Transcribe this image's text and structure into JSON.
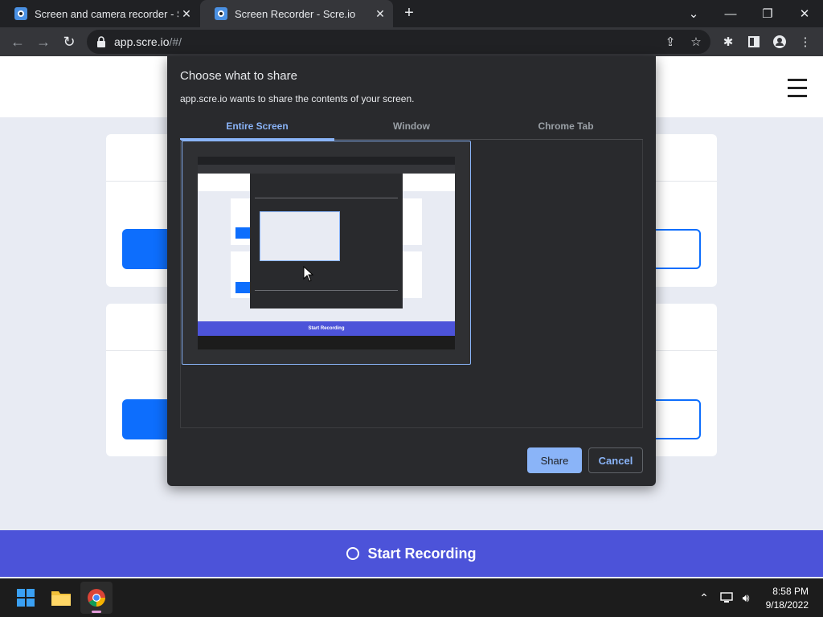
{
  "browser": {
    "tabs": [
      {
        "title": "Screen and camera recorder - Scre",
        "active": false
      },
      {
        "title": "Screen Recorder - Scre.io",
        "active": true
      }
    ],
    "new_tab": "+",
    "url_host": "app.scre.io",
    "url_path": "/#/"
  },
  "page": {
    "start_recording": "Start Recording"
  },
  "dialog": {
    "title": "Choose what to share",
    "subtitle": "app.scre.io wants to share the contents of your screen.",
    "tabs": [
      "Entire Screen",
      "Window",
      "Chrome Tab"
    ],
    "active_tab": "Entire Screen",
    "share_label": "Share",
    "cancel_label": "Cancel",
    "preview_caption": "Start Recording"
  },
  "taskbar": {
    "time": "8:58 PM",
    "date": "9/18/2022"
  },
  "colors": {
    "accent": "#8ab4f8",
    "brand_blue": "#0d6efd",
    "record_bar": "#4c53d9",
    "dialog_bg": "#292a2d"
  }
}
